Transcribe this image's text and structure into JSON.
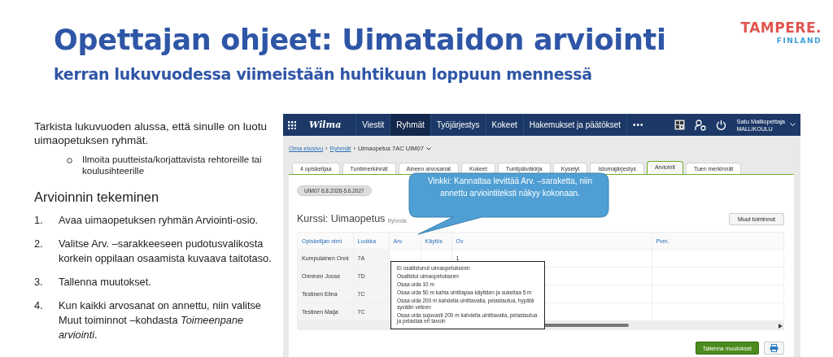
{
  "slide": {
    "title": "Opettajan ohjeet: Uimataidon arviointi",
    "subtitle": "kerran lukuvuodessa viimeistään huhtikuun loppuun mennessä",
    "logo": {
      "name": "TAMPERE.",
      "sub": "FINLAND"
    }
  },
  "instructions": {
    "intro": "Tarkista lukuvuoden alussa, että sinulle on luotu uimaopetuksen ryhmät.",
    "note": "Ilmoita puutteista/korjattavista rehtoreille tai koulusihteerille",
    "heading": "Arvioinnin tekeminen",
    "steps": [
      {
        "number": "1.",
        "text": "Avaa uimaopetuksen ryhmän Arviointi-osio."
      },
      {
        "number": "2.",
        "text": "Valitse Arv. –sarakkeeseen pudotusvalikosta korkein oppilaan osaamista kuvaava taitotaso."
      },
      {
        "number": "3.",
        "text": "Tallenna muutokset."
      },
      {
        "number": "4.",
        "text": "Kun kaikki arvosanat on annettu, niin valitse Muut toiminnot –kohdasta *Toimeenpane arviointi*."
      }
    ]
  },
  "app": {
    "navbar": {
      "logo": "Wilma",
      "items": [
        {
          "label": "Viestit",
          "selected": false
        },
        {
          "label": "Ryhmät",
          "selected": true
        },
        {
          "label": "Työjärjestys",
          "selected": false
        },
        {
          "label": "Kokeet",
          "selected": false
        },
        {
          "label": "Hakemukset ja päätökset",
          "selected": false
        }
      ],
      "more": "•••",
      "user": {
        "name": "Satu Malliopettaja",
        "school": "MALLIKOULU"
      }
    },
    "breadcrumb": {
      "links": [
        "Oma etusivu",
        "Ryhmät"
      ],
      "separator": "›",
      "current": "Uimaopetus 7AC UIM07"
    },
    "tabs": [
      {
        "label": "4 opiskelijaa",
        "selected": false
      },
      {
        "label": "Tuntimerkinnät",
        "selected": false
      },
      {
        "label": "Aineen arvosanat",
        "selected": false
      },
      {
        "label": "Kokeet",
        "selected": false
      },
      {
        "label": "Tuntipäiväkirja",
        "selected": false
      },
      {
        "label": "Kyselyt",
        "selected": false
      },
      {
        "label": "Istumajärjestys",
        "selected": false
      },
      {
        "label": "Arviointi",
        "selected": true
      },
      {
        "label": "Tuen merkinnät",
        "selected": false
      }
    ],
    "period": "UIM07 6.8.2026-5.6.2027",
    "callout": "Vinkki: Kannattaa levittää Arv. –saraketta, niin annettu arviointiteksti näkyy kokonaan.",
    "course_title": "Kurssi: Uimaopetus",
    "course_note": "Ryhmäk",
    "actions_button": "Muut toiminnot",
    "table": {
      "columns": [
        "Opiskelijan nimi",
        "Luokka",
        "Arv.",
        "Käytös",
        "Ov",
        "Pvm."
      ],
      "rows": [
        {
          "cells": [
            "Kumpulainen Onni",
            "7A",
            "",
            "",
            "1",
            ""
          ]
        },
        {
          "cells": [
            "Onninen Joose",
            "7D",
            "",
            "",
            "",
            ""
          ]
        },
        {
          "cells": [
            "Testinen Elina",
            "7C",
            "",
            "",
            "",
            ""
          ]
        },
        {
          "cells": [
            "Testinen Maija",
            "7C",
            "",
            "",
            "",
            ""
          ]
        }
      ]
    },
    "dropdown": [
      "Ei osallistunut uimaopetukseen",
      "Osallistui uimaopetukseen",
      "Osaa uida 10 m",
      "Osaa uida 50 m kahta uintitapaa käyttäen ja sukeltaa 5 m",
      "Osaa uida 200 m kahdella uintitavalla, pelastautua, hypätä syvään veteen",
      "Osaa uida sujuvasti 200 m kahdella uintitavalla, pelastautua ja pelastaa eri tavoin"
    ],
    "save_button": "Tallenna muutokset"
  }
}
